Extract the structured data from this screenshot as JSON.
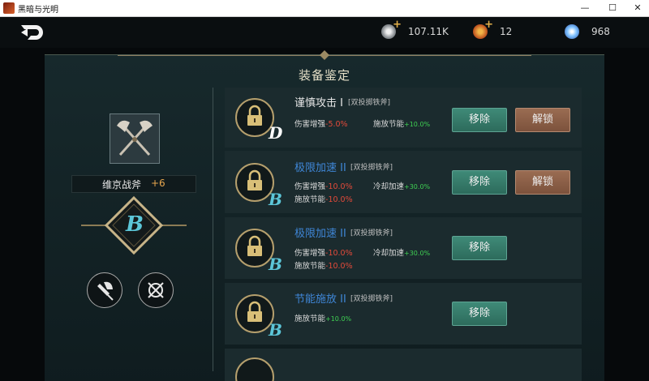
{
  "window": {
    "title": "黑暗与光明",
    "minimize": "—",
    "maximize": "☐",
    "close": "✕"
  },
  "resources": [
    {
      "icon": "silver-coin-icon",
      "value": "107.11K"
    },
    {
      "icon": "gold-medal-icon",
      "value": "12"
    },
    {
      "icon": "crystal-orb-icon",
      "value": "968"
    }
  ],
  "panel": {
    "title": "装备鉴定"
  },
  "weapon": {
    "name": "维京战斧",
    "plus": "+6",
    "grade": "B",
    "icon": "double-axe-icon"
  },
  "colors": {
    "red": "#e34a3a",
    "green": "#3fd053",
    "blue_name": "#3f86d6",
    "white_name": "#e6e6e6"
  },
  "effects": [
    {
      "grade": "D",
      "grade_color": "#ffffff",
      "name": "谨慎攻击 I",
      "name_color": "#e6e6e6",
      "weapon": "[双投掷铁斧]",
      "stat1_label": "伤害增强",
      "stat1_value": "-5.0%",
      "stat2_label": "施放节能",
      "stat2_value": "+10.0%",
      "stat3_label": "",
      "stat3_value": "",
      "remove": "移除",
      "unlock": "解锁"
    },
    {
      "grade": "B",
      "grade_color": "#5cc6d8",
      "name": "极限加速 II",
      "name_color": "#3f86d6",
      "weapon": "[双投掷铁斧]",
      "stat1_label": "伤害增强",
      "stat1_value": "-10.0%",
      "stat2_label": "冷却加速",
      "stat2_value": "+30.0%",
      "stat3_label": "施放节能",
      "stat3_value": "-10.0%",
      "remove": "移除",
      "unlock": "解锁"
    },
    {
      "grade": "B",
      "grade_color": "#5cc6d8",
      "name": "极限加速 II",
      "name_color": "#3f86d6",
      "weapon": "[双投掷铁斧]",
      "stat1_label": "伤害增强",
      "stat1_value": "-10.0%",
      "stat2_label": "冷却加速",
      "stat2_value": "+30.0%",
      "stat3_label": "施放节能",
      "stat3_value": "-10.0%",
      "remove": "移除"
    },
    {
      "grade": "B",
      "grade_color": "#5cc6d8",
      "name": "节能施放 II",
      "name_color": "#3f86d6",
      "weapon": "[双投掷铁斧]",
      "stat1_label": "施放节能",
      "stat1_value": "+10.0%",
      "remove": "移除"
    }
  ]
}
